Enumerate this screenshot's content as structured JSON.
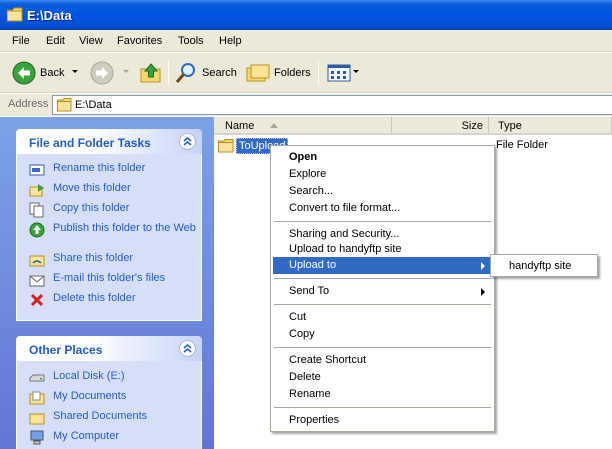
{
  "window": {
    "title": "E:\\Data"
  },
  "menu": [
    "File",
    "Edit",
    "View",
    "Favorites",
    "Tools",
    "Help"
  ],
  "toolbar": {
    "back_label": "Back",
    "search_label": "Search",
    "folders_label": "Folders"
  },
  "address": {
    "label": "Address",
    "value": "E:\\Data"
  },
  "tasks": {
    "title": "File and Folder Tasks",
    "items": [
      {
        "label": "Rename this folder",
        "icon": "rename-icon"
      },
      {
        "label": "Move this folder",
        "icon": "move-icon"
      },
      {
        "label": "Copy this folder",
        "icon": "copy-icon"
      },
      {
        "label": "Publish this folder to the Web",
        "icon": "publish-web-icon"
      },
      {
        "label": "Share this folder",
        "icon": "share-icon"
      },
      {
        "label": "E-mail this folder's files",
        "icon": "email-icon"
      },
      {
        "label": "Delete this folder",
        "icon": "delete-icon"
      }
    ]
  },
  "places": {
    "title": "Other Places",
    "items": [
      {
        "label": "Local Disk (E:)",
        "icon": "disk-icon"
      },
      {
        "label": "My Documents",
        "icon": "folder-icon"
      },
      {
        "label": "Shared Documents",
        "icon": "folder-icon"
      },
      {
        "label": "My Computer",
        "icon": "computer-icon"
      }
    ]
  },
  "columns": {
    "name": "Name",
    "size": "Size",
    "type": "Type"
  },
  "files": [
    {
      "name": "ToUpload",
      "type": "File Folder"
    }
  ],
  "context_menu": {
    "open": "Open",
    "explore": "Explore",
    "search": "Search...",
    "convert": "Convert to file format...",
    "sharing": "Sharing and Security...",
    "upload_handy": "Upload to handyftp site",
    "upload_to": "Upload to",
    "send_to": "Send To",
    "cut": "Cut",
    "copy": "Copy",
    "create_shortcut": "Create Shortcut",
    "delete": "Delete",
    "rename": "Rename",
    "properties": "Properties"
  },
  "submenu": {
    "item": "handyftp site"
  },
  "colors": {
    "titlebar": "#0054e3",
    "selection": "#316ac5",
    "task_link": "#215dc6",
    "taskpane_bg": "#7ba2e7"
  }
}
